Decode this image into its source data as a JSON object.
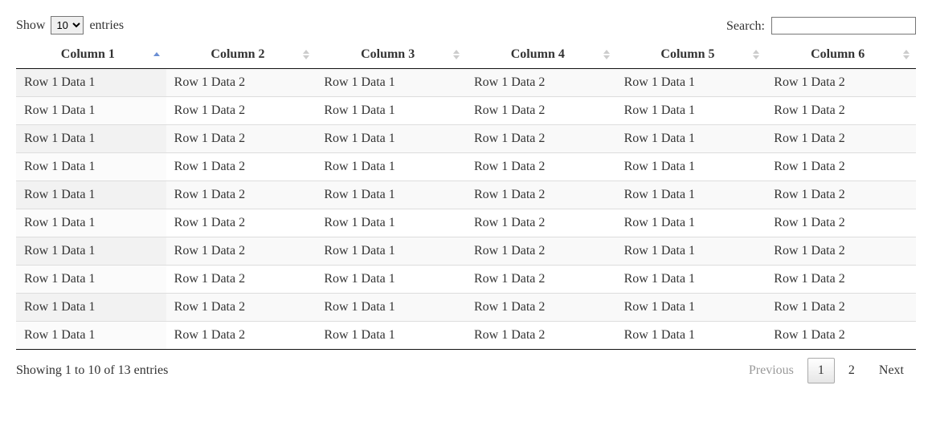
{
  "lengthControl": {
    "prefix": "Show",
    "suffix": "entries",
    "selected": "10"
  },
  "searchControl": {
    "label": "Search:",
    "value": ""
  },
  "columns": [
    {
      "label": "Column 1",
      "sorted": "asc"
    },
    {
      "label": "Column 2",
      "sorted": "none"
    },
    {
      "label": "Column 3",
      "sorted": "none"
    },
    {
      "label": "Column 4",
      "sorted": "none"
    },
    {
      "label": "Column 5",
      "sorted": "none"
    },
    {
      "label": "Column 6",
      "sorted": "none"
    }
  ],
  "rows": [
    [
      "Row 1 Data 1",
      "Row 1 Data 2",
      "Row 1 Data 1",
      "Row 1 Data 2",
      "Row 1 Data 1",
      "Row 1 Data 2"
    ],
    [
      "Row 1 Data 1",
      "Row 1 Data 2",
      "Row 1 Data 1",
      "Row 1 Data 2",
      "Row 1 Data 1",
      "Row 1 Data 2"
    ],
    [
      "Row 1 Data 1",
      "Row 1 Data 2",
      "Row 1 Data 1",
      "Row 1 Data 2",
      "Row 1 Data 1",
      "Row 1 Data 2"
    ],
    [
      "Row 1 Data 1",
      "Row 1 Data 2",
      "Row 1 Data 1",
      "Row 1 Data 2",
      "Row 1 Data 1",
      "Row 1 Data 2"
    ],
    [
      "Row 1 Data 1",
      "Row 1 Data 2",
      "Row 1 Data 1",
      "Row 1 Data 2",
      "Row 1 Data 1",
      "Row 1 Data 2"
    ],
    [
      "Row 1 Data 1",
      "Row 1 Data 2",
      "Row 1 Data 1",
      "Row 1 Data 2",
      "Row 1 Data 1",
      "Row 1 Data 2"
    ],
    [
      "Row 1 Data 1",
      "Row 1 Data 2",
      "Row 1 Data 1",
      "Row 1 Data 2",
      "Row 1 Data 1",
      "Row 1 Data 2"
    ],
    [
      "Row 1 Data 1",
      "Row 1 Data 2",
      "Row 1 Data 1",
      "Row 1 Data 2",
      "Row 1 Data 1",
      "Row 1 Data 2"
    ],
    [
      "Row 1 Data 1",
      "Row 1 Data 2",
      "Row 1 Data 1",
      "Row 1 Data 2",
      "Row 1 Data 1",
      "Row 1 Data 2"
    ],
    [
      "Row 1 Data 1",
      "Row 1 Data 2",
      "Row 1 Data 1",
      "Row 1 Data 2",
      "Row 1 Data 1",
      "Row 1 Data 2"
    ]
  ],
  "info": "Showing 1 to 10 of 13 entries",
  "pagination": {
    "previous": "Previous",
    "next": "Next",
    "pages": [
      {
        "label": "1",
        "current": true
      },
      {
        "label": "2",
        "current": false
      }
    ]
  }
}
